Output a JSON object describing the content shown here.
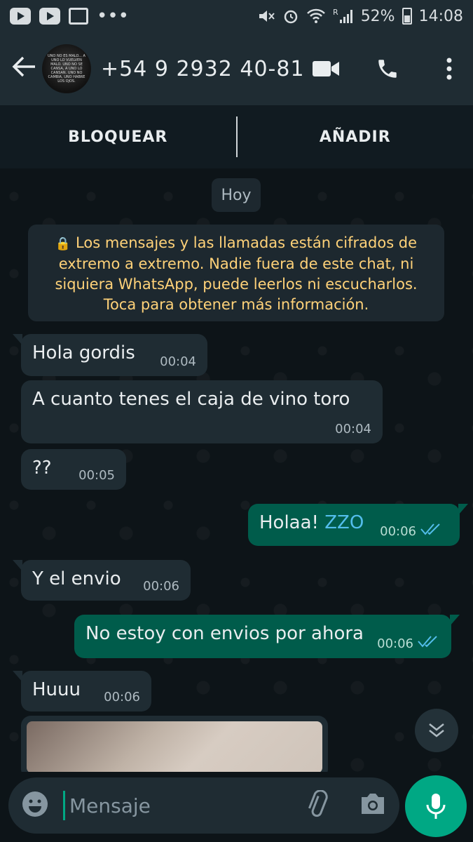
{
  "status_bar": {
    "battery": "52%",
    "time": "14:08",
    "network_label": "R"
  },
  "header": {
    "contact_name": "+54 9 2932 40-81...",
    "avatar_text": "UNO NO ES MALO... A UNO LO VUELVEN MALO. UNO NO SE CANSA, A UNO LO CANSAN. UNO NO CAMBIA, UNO HABRE LOS OJOS.",
    "icons": [
      "back-arrow-icon",
      "video-call-icon",
      "phone-icon",
      "more-options-icon"
    ]
  },
  "block_bar": {
    "block_label": "BLOQUEAR",
    "add_label": "AÑADIR"
  },
  "date_chip": "Hoy",
  "encryption_notice": "Los mensajes y las llamadas están cifrados de extremo a extremo. Nadie fuera de este chat, ni siquiera WhatsApp, puede leerlos ni escucharlos. Toca para obtener más información.",
  "messages": [
    {
      "dir": "in",
      "text": "Hola gordis",
      "time": "00:04"
    },
    {
      "dir": "in",
      "text": "A  cuanto tenes el caja de vino toro",
      "time": "00:04"
    },
    {
      "dir": "in",
      "text": "??",
      "time": "00:05"
    },
    {
      "dir": "out",
      "text": "Holaa!",
      "extra": "ZZO",
      "time": "00:06"
    },
    {
      "dir": "in",
      "text": "Y el envio",
      "time": "00:06"
    },
    {
      "dir": "out",
      "text": "No estoy con envios por ahora",
      "time": "00:06"
    },
    {
      "dir": "in",
      "text": "Huuu",
      "time": "00:06"
    }
  ],
  "input": {
    "placeholder": "Mensaje"
  },
  "colors": {
    "header_bg": "#1f2c33",
    "incoming_bubble": "#1f2c33",
    "outgoing_bubble": "#005c4b",
    "accent": "#00a884",
    "read_ticks": "#53bdeb",
    "notice_text": "#ffd279"
  }
}
